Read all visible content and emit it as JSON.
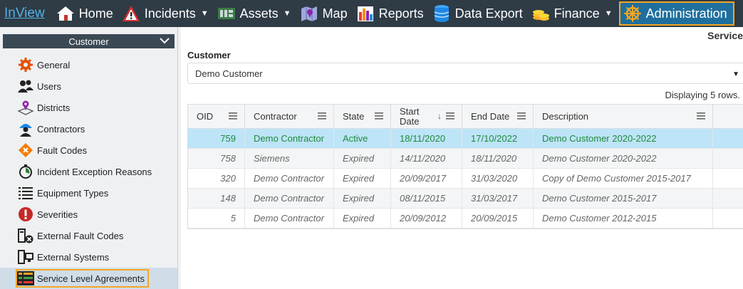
{
  "app": {
    "brand": "InView"
  },
  "nav": {
    "items": [
      {
        "label": "Home",
        "icon": "home-icon"
      },
      {
        "label": "Incidents",
        "icon": "warning-icon"
      },
      {
        "label": "Assets",
        "icon": "circuit-board-icon"
      },
      {
        "label": "Map",
        "icon": "map-icon"
      },
      {
        "label": "Reports",
        "icon": "bar-chart-icon"
      },
      {
        "label": "Data Export",
        "icon": "database-icon"
      },
      {
        "label": "Finance",
        "icon": "coins-icon"
      },
      {
        "label": "Administration",
        "icon": "ship-wheel-icon"
      }
    ]
  },
  "sidebar": {
    "header": "Customer",
    "items": [
      {
        "label": "General",
        "icon": "gear-icon"
      },
      {
        "label": "Users",
        "icon": "users-icon"
      },
      {
        "label": "Districts",
        "icon": "location-pin-icon"
      },
      {
        "label": "Contractors",
        "icon": "worker-icon"
      },
      {
        "label": "Fault Codes",
        "icon": "fault-diamond-icon"
      },
      {
        "label": "Incident Exception Reasons",
        "icon": "stopwatch-icon"
      },
      {
        "label": "Equipment Types",
        "icon": "list-icon"
      },
      {
        "label": "Severities",
        "icon": "exclamation-icon"
      },
      {
        "label": "External Fault Codes",
        "icon": "computer-error-icon"
      },
      {
        "label": "External Systems",
        "icon": "computer-icon"
      },
      {
        "label": "Service Level Agreements",
        "icon": "sla-grid-icon"
      }
    ]
  },
  "main": {
    "title": "Service",
    "customer_label": "Customer",
    "customer_value": "Demo Customer",
    "row_count": "Displaying 5 rows.",
    "columns": [
      "OID",
      "Contractor",
      "State",
      "Start Date",
      "End Date",
      "Description"
    ],
    "rows": [
      {
        "oid": "759",
        "contractor": "Demo Contractor",
        "state": "Active",
        "start": "18/11/2020",
        "end": "17/10/2022",
        "description": "Demo Customer 2020-2022"
      },
      {
        "oid": "758",
        "contractor": "Siemens",
        "state": "Expired",
        "start": "14/11/2020",
        "end": "18/11/2020",
        "description": "Demo Customer 2020-2022"
      },
      {
        "oid": "320",
        "contractor": "Demo Contractor",
        "state": "Expired",
        "start": "20/09/2017",
        "end": "31/03/2020",
        "description": "Copy of Demo Customer 2015-2017"
      },
      {
        "oid": "148",
        "contractor": "Demo Contractor",
        "state": "Expired",
        "start": "08/11/2015",
        "end": "31/03/2017",
        "description": "Demo Customer 2015-2017"
      },
      {
        "oid": "5",
        "contractor": "Demo Contractor",
        "state": "Expired",
        "start": "20/09/2012",
        "end": "20/09/2015",
        "description": "Demo Customer 2012-2015"
      }
    ]
  },
  "colors": {
    "nav_bg": "#2f3b45",
    "accent": "#f5a623",
    "active_row": "#bde4f7",
    "active_text": "#1e8a3c"
  }
}
